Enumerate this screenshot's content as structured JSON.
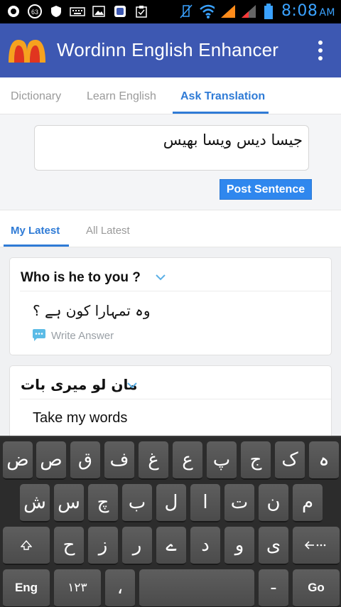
{
  "status_bar": {
    "time": "8:08",
    "ampm": "AM",
    "notification_count": "63"
  },
  "app_bar": {
    "title": "Wordinn English Enhancer"
  },
  "tabs": [
    {
      "label": "Dictionary"
    },
    {
      "label": "Learn English"
    },
    {
      "label": "Ask Translation"
    }
  ],
  "ask": {
    "input_value": "جیسا دیس ویسا بھیس",
    "post_label": "Post Sentence"
  },
  "subtabs": [
    {
      "label": "My Latest"
    },
    {
      "label": "All Latest"
    }
  ],
  "questions": [
    {
      "title": "Who is he to you ?",
      "answer": "وہ تمہارا کون ہے ؟",
      "write_answer": "Write Answer"
    },
    {
      "title": "مان لو میری بات",
      "answer": "Take my words"
    }
  ],
  "keyboard": {
    "row1": [
      "ض",
      "ص",
      "ق",
      "ف",
      "غ",
      "ع",
      "پ",
      "ج",
      "ک",
      "ہ"
    ],
    "row2": [
      "ش",
      "س",
      "چ",
      "ب",
      "ل",
      "ا",
      "ت",
      "ن",
      "م"
    ],
    "row3": [
      "ح",
      "ز",
      "ر",
      "ے",
      "د",
      "و",
      "ی"
    ],
    "eng": "Eng",
    "numbers": "۱۲۳",
    "comma": "،",
    "dash": "-",
    "go": "Go"
  },
  "colors": {
    "appbar": "#3d58b2",
    "accent": "#2f7bd6",
    "post_button": "#2f87ee"
  }
}
